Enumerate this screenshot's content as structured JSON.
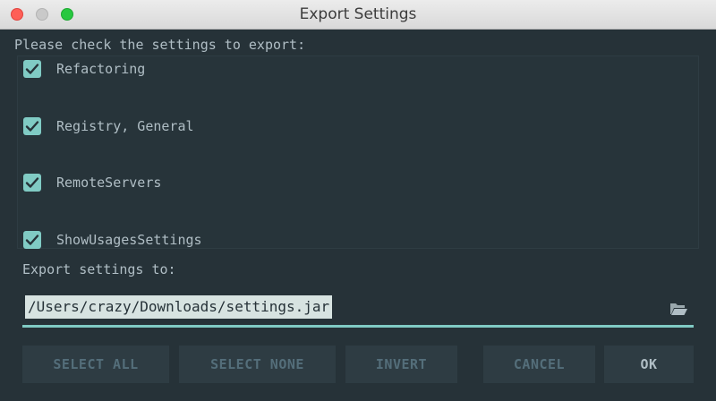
{
  "window": {
    "title": "Export Settings"
  },
  "dialog": {
    "prompt": "Please check the settings to export:",
    "settings": [
      {
        "label": "Refactoring",
        "checked": true
      },
      {
        "label": "Registry, General",
        "checked": true
      },
      {
        "label": "RemoteServers",
        "checked": true
      },
      {
        "label": "ShowUsagesSettings",
        "checked": true
      }
    ],
    "export_label": "Export settings to:",
    "export_path": "/Users/crazy/Downloads/settings.jar",
    "browse_icon": "folder-open-icon"
  },
  "buttons": {
    "select_all": "SELECT ALL",
    "select_none": "SELECT NONE",
    "invert": "INVERT",
    "cancel": "CANCEL",
    "ok": "OK"
  },
  "colors": {
    "background": "#263238",
    "accent": "#80cbc4",
    "text": "#b0bec5",
    "button_bg": "#2e3c43",
    "button_text": "#546e7a"
  }
}
